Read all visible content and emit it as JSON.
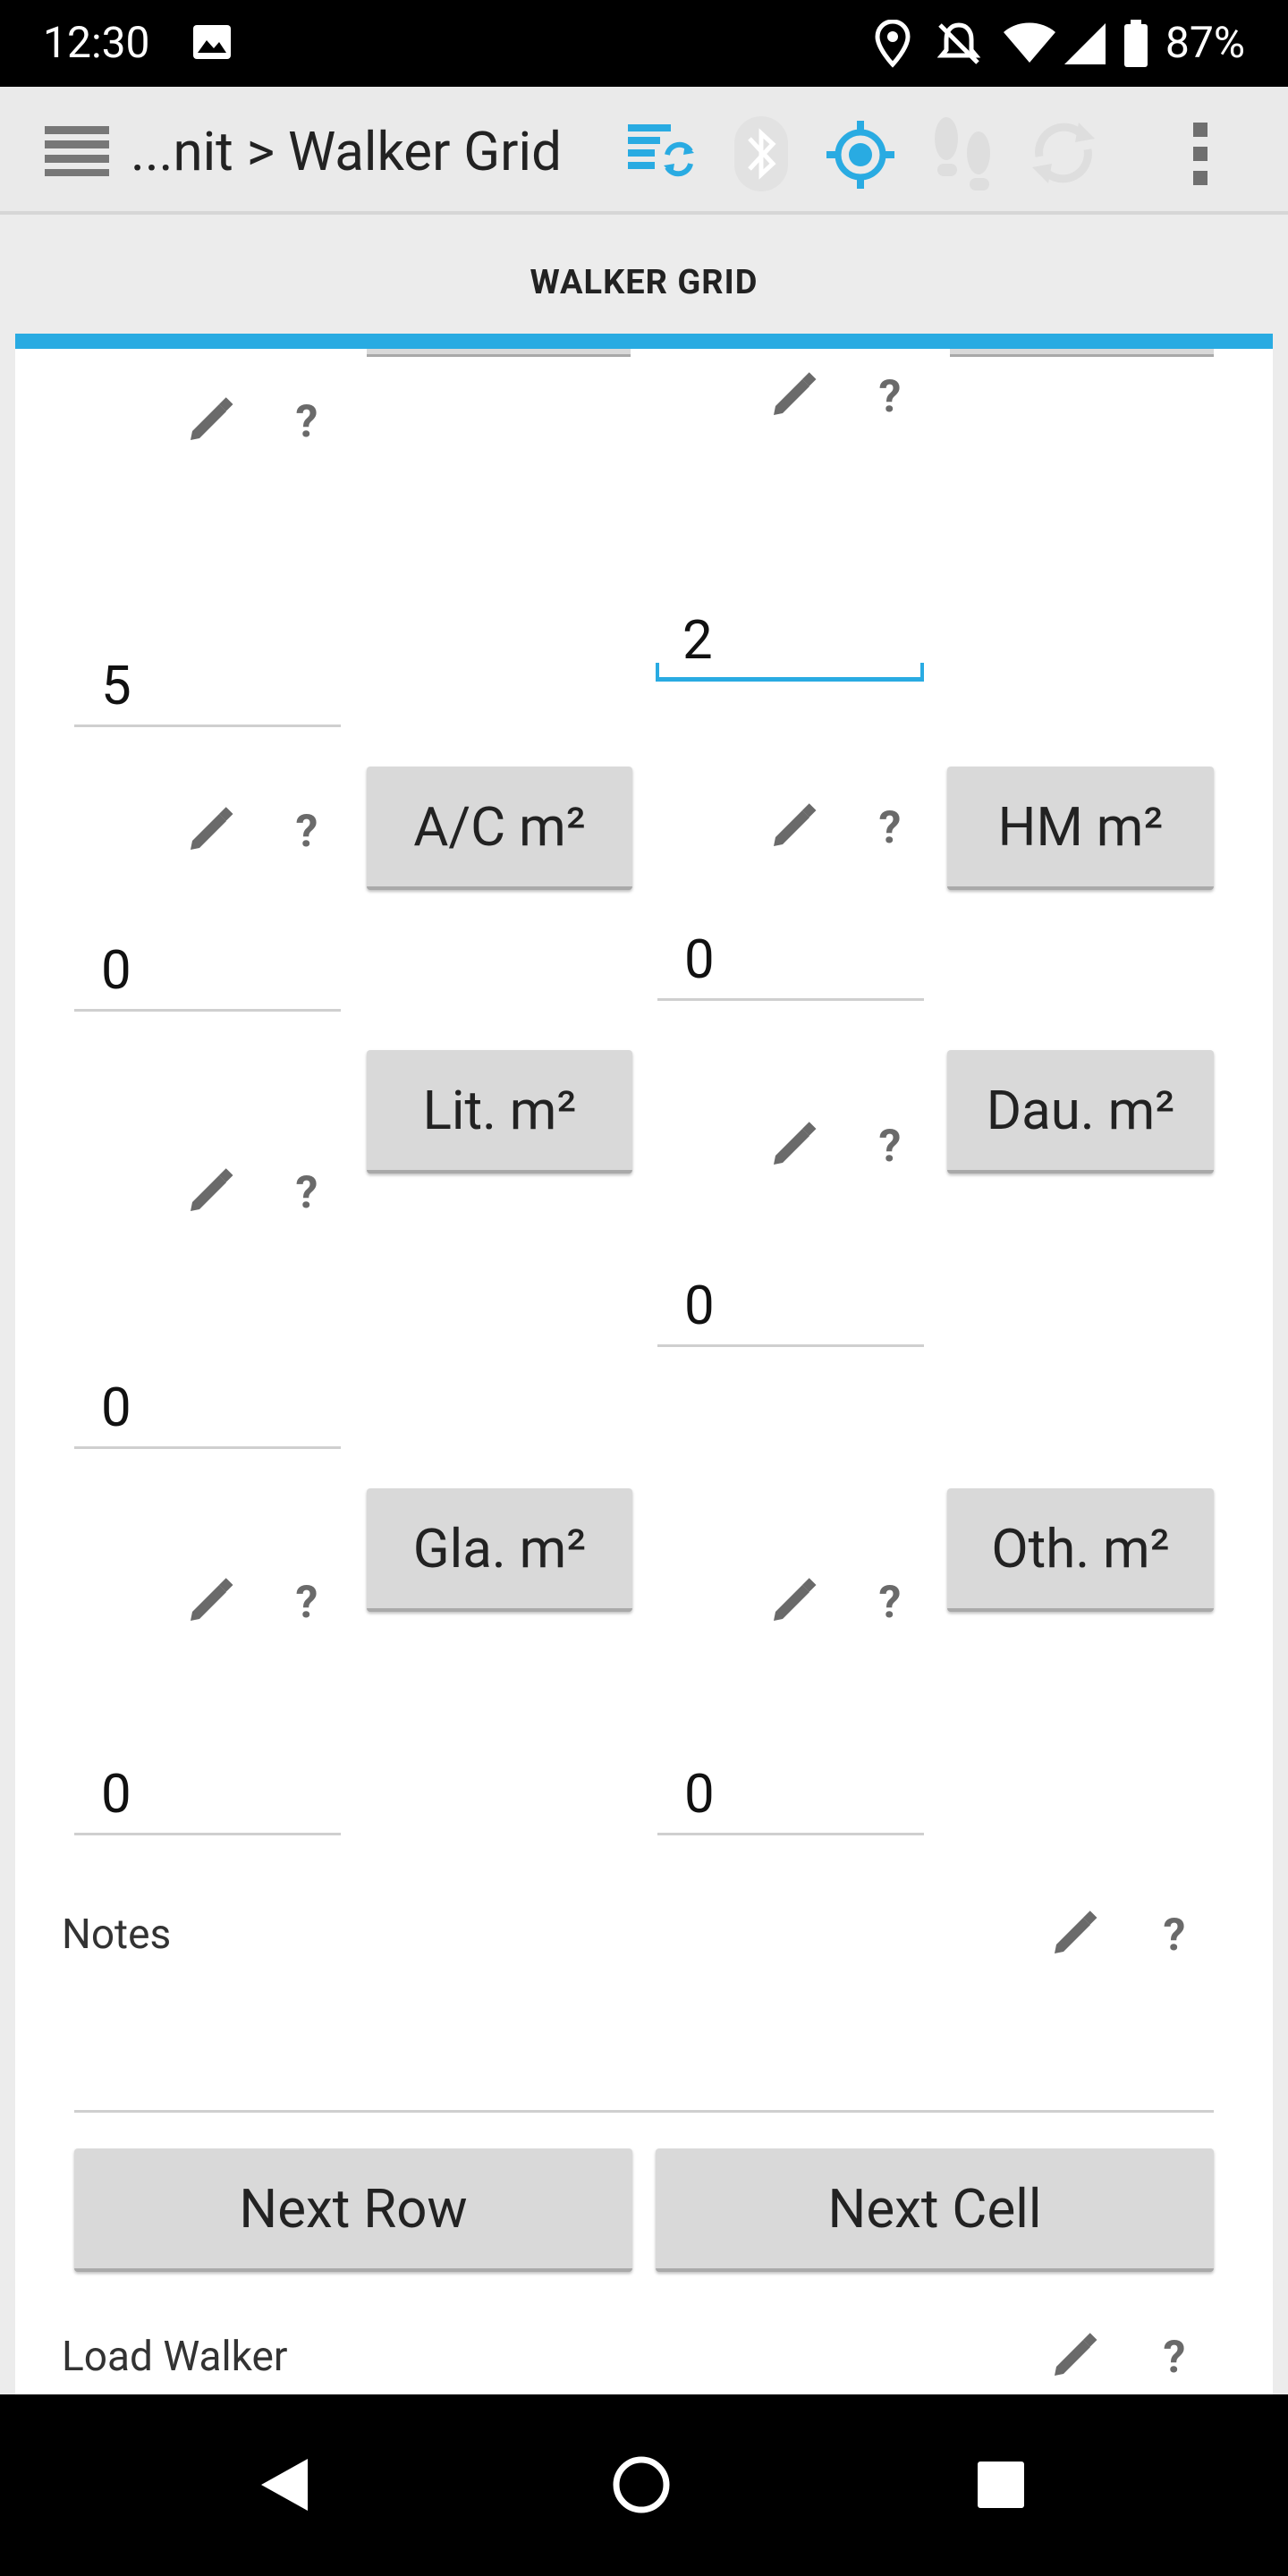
{
  "status_bar": {
    "time": "12:30",
    "battery": "87%"
  },
  "app_bar": {
    "title": "...nit > Walker Grid"
  },
  "tab": {
    "label": "WALKER GRID"
  },
  "grid": {
    "left_col_top_value": "5",
    "right_col_top_value": "2",
    "ac_button": "A/C m²",
    "hm_button": "HM m²",
    "ac_value": "0",
    "hm_value": "0",
    "lit_button": "Lit. m²",
    "dau_button": "Dau. m²",
    "dau_value": "0",
    "lit_value": "0",
    "gla_button": "Gla. m²",
    "oth_button": "Oth. m²",
    "gla_value": "0",
    "oth_value": "0"
  },
  "notes": {
    "label": "Notes",
    "value": ""
  },
  "actions": {
    "next_row": "Next Row",
    "next_cell": "Next Cell"
  },
  "load_walker": {
    "label": "Load Walker"
  },
  "help_glyph": "?",
  "colors": {
    "accent": "#29abe2",
    "button_bg": "#d9d9d9",
    "icon_gray": "#6a6a6a"
  }
}
